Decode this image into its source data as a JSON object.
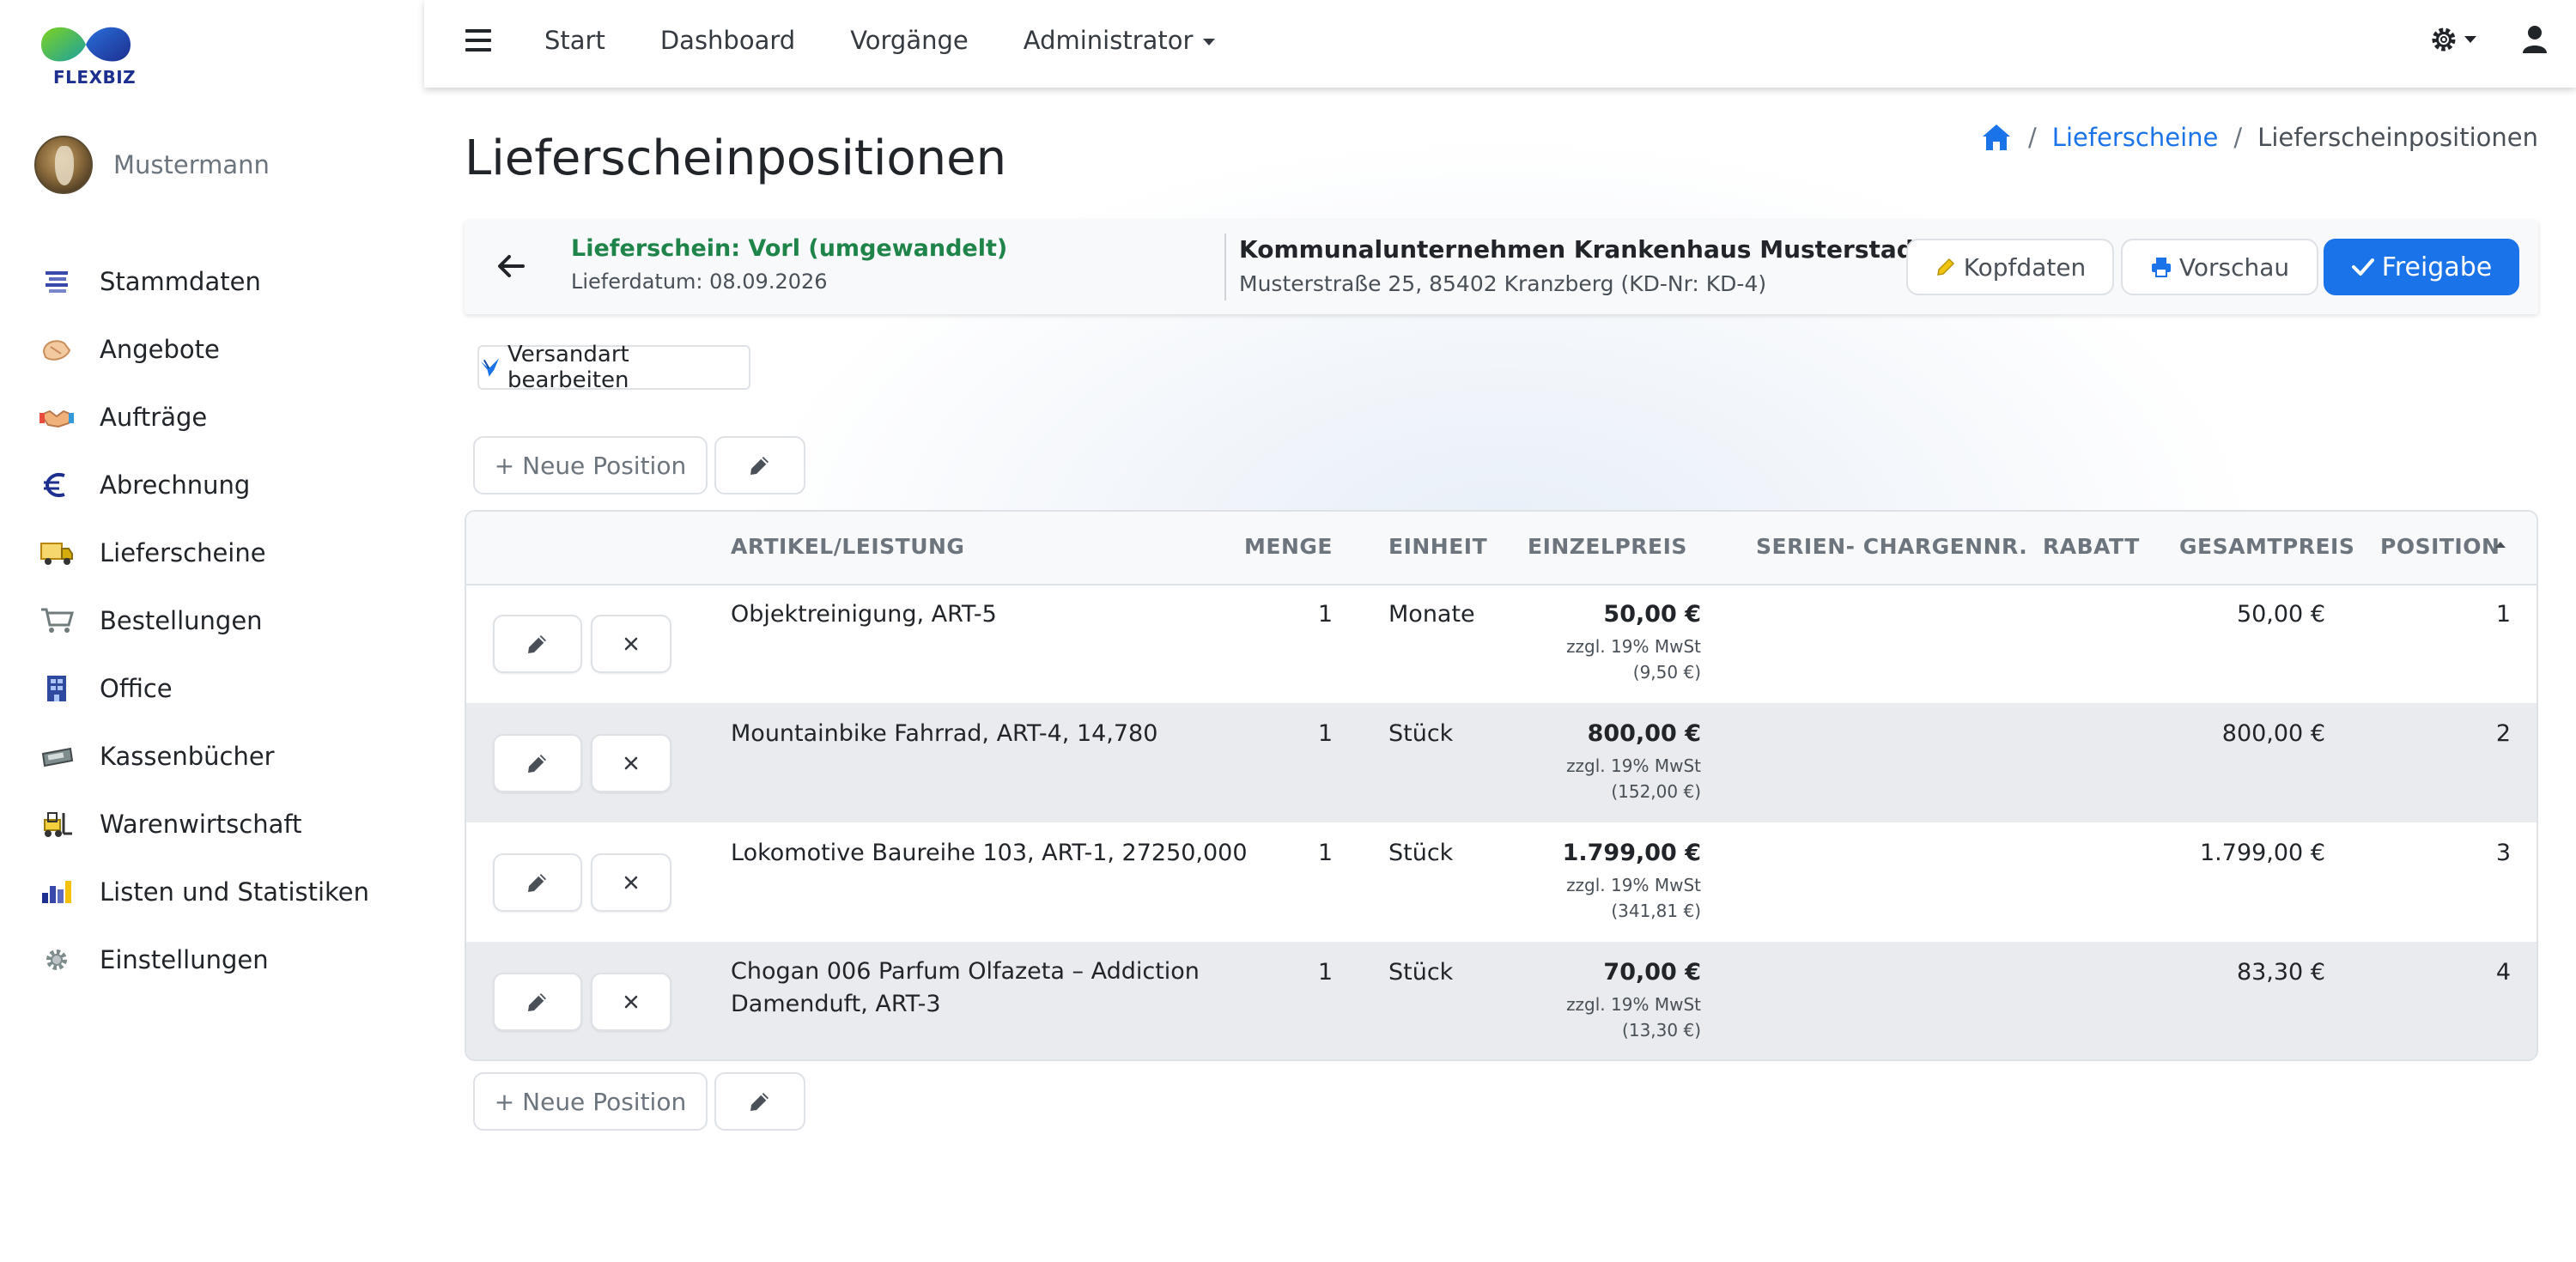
{
  "brand": {
    "logo_text": "FLEXBIZ",
    "colors": {
      "primary": "#1a73e8",
      "success": "#1e8449"
    }
  },
  "user": {
    "name": "Mustermann"
  },
  "sidebar": {
    "items": [
      {
        "label": "Stammdaten",
        "icon": "master-data-icon"
      },
      {
        "label": "Angebote",
        "icon": "offers-icon"
      },
      {
        "label": "Aufträge",
        "icon": "handshake-icon"
      },
      {
        "label": "Abrechnung",
        "icon": "euro-icon"
      },
      {
        "label": "Lieferscheine",
        "icon": "delivery-truck-icon"
      },
      {
        "label": "Bestellungen",
        "icon": "shopping-cart-icon"
      },
      {
        "label": "Office",
        "icon": "office-icon"
      },
      {
        "label": "Kassenbücher",
        "icon": "cash-register-icon"
      },
      {
        "label": "Warenwirtschaft",
        "icon": "forklift-icon"
      },
      {
        "label": "Listen und Statistiken",
        "icon": "bar-chart-icon"
      },
      {
        "label": "Einstellungen",
        "icon": "gear-icon"
      }
    ]
  },
  "topnav": {
    "start": "Start",
    "dashboard": "Dashboard",
    "vorgaenge": "Vorgänge",
    "administrator": "Administrator"
  },
  "page": {
    "title": "Lieferscheinpositionen"
  },
  "breadcrumb": {
    "level1": "Lieferscheine",
    "current": "Lieferscheinpositionen"
  },
  "header": {
    "ls_title": "Lieferschein: Vorl (umgewandelt)",
    "ls_date": "Lieferdatum: 08.09.2026",
    "customer_name": "Kommunalunternehmen Krankenhaus Musterstadt",
    "customer_address": "Musterstraße 25, 85402 Kranzberg (KD-Nr: KD-4)",
    "btn_kopfdaten": "Kopfdaten",
    "btn_vorschau": "Vorschau",
    "btn_freigabe": "Freigabe"
  },
  "actions": {
    "versandart": "Versandart bearbeiten",
    "neue_position": "+ Neue Position"
  },
  "table": {
    "columns": {
      "artikel": "ARTIKEL/LEISTUNG",
      "menge": "MENGE",
      "einheit": "EINHEIT",
      "einzelpreis": "EINZELPREIS",
      "serien": "SERIEN- CHARGENNR.",
      "rabatt": "RABATT",
      "gesamtpreis": "GESAMTPREIS",
      "position": "POSITION"
    },
    "sort": {
      "column": "POSITION",
      "direction": "ascending"
    },
    "rows": [
      {
        "artikel": "Objektreinigung, ART-5",
        "menge": "1",
        "einheit": "Monate",
        "einzelpreis": "50,00 €",
        "tax_note": "zzgl. 19% MwSt (9,50 €)",
        "serien": "",
        "rabatt": "",
        "gesamtpreis": "50,00 €",
        "position": "1"
      },
      {
        "artikel": "Mountainbike Fahrrad, ART-4, 14,780",
        "menge": "1",
        "einheit": "Stück",
        "einzelpreis": "800,00 €",
        "tax_note": "zzgl. 19% MwSt (152,00 €)",
        "serien": "",
        "rabatt": "",
        "gesamtpreis": "800,00 €",
        "position": "2"
      },
      {
        "artikel": "Lokomotive Baureihe 103, ART-1, 27250,000",
        "menge": "1",
        "einheit": "Stück",
        "einzelpreis": "1.799,00 €",
        "tax_note": "zzgl. 19% MwSt (341,81 €)",
        "serien": "",
        "rabatt": "",
        "gesamtpreis": "1.799,00 €",
        "position": "3"
      },
      {
        "artikel": "Chogan 006 Parfum Olfazeta – Addiction Damenduft, ART-3",
        "menge": "1",
        "einheit": "Stück",
        "einzelpreis": "70,00 €",
        "tax_note": "zzgl. 19% MwSt (13,30 €)",
        "serien": "",
        "rabatt": "",
        "gesamtpreis": "83,30 €",
        "position": "4"
      }
    ]
  }
}
